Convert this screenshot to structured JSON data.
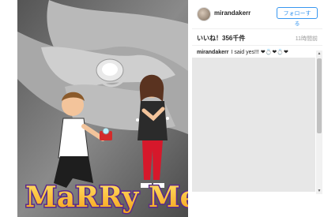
{
  "post": {
    "username": "mirandakerr",
    "follow_label": "フォローする",
    "likes": "いいね！356千件",
    "time": "11時間前",
    "caption_user": "mirandakerr",
    "caption_text": "I said yes!!! ❤💍❤💍❤"
  },
  "photo": {
    "sticker_text": "MaRRy Me!"
  }
}
